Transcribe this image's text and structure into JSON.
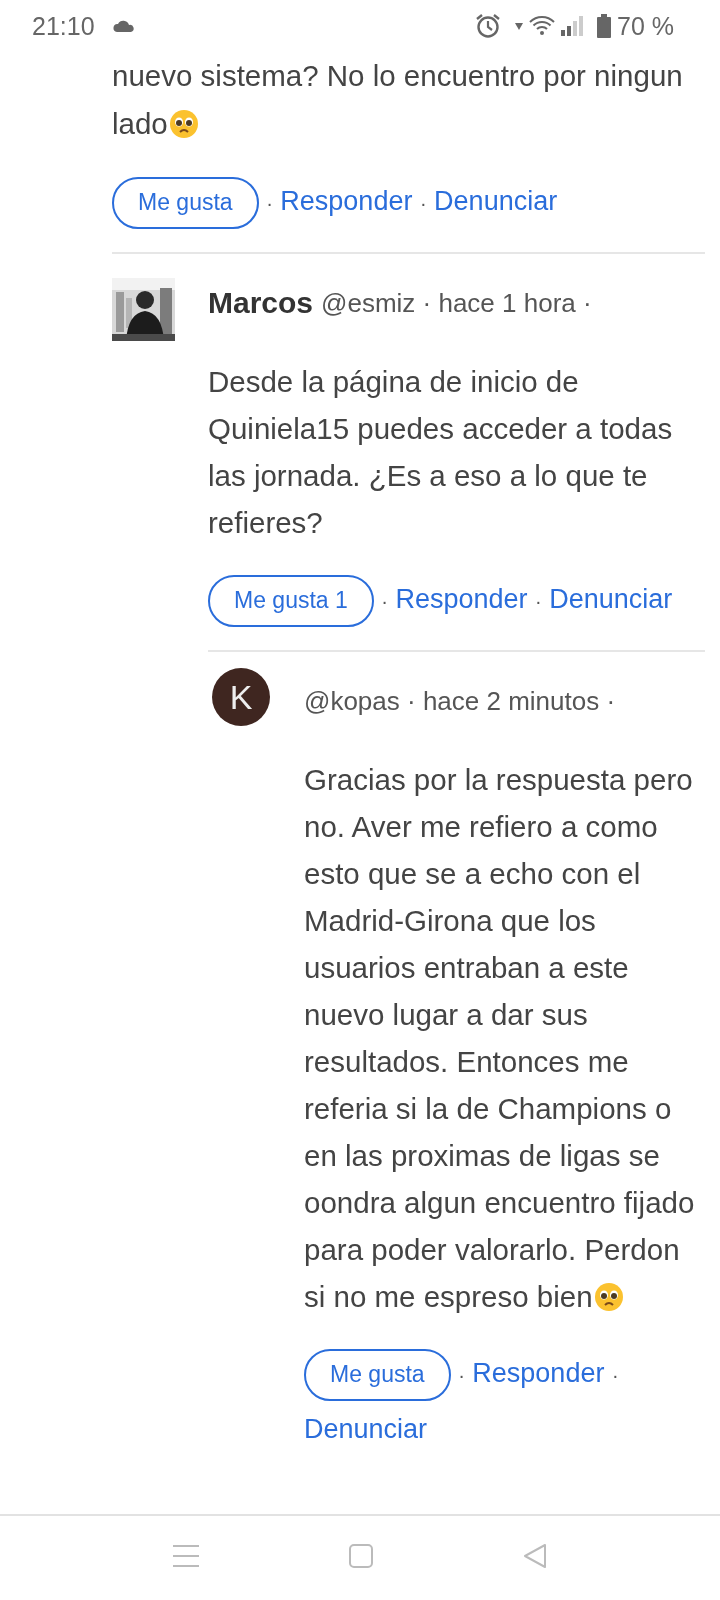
{
  "status_bar": {
    "time": "21:10",
    "battery": "70 %"
  },
  "comments": [
    {
      "body": "nuevo sistema? No lo encuentro por ningun lado",
      "emoji": true,
      "like": "Me gusta",
      "actions": [
        {
          "sep": "·",
          "label": "Responder"
        },
        {
          "sep": "·",
          "label": "Denunciar"
        }
      ],
      "children": [
        {
          "avatar": {
            "kind": "picture"
          },
          "name": "Marcos",
          "meta": "@esmiz · hace 1 hora ·",
          "body": "Desde la página de inicio de Quiniela15 puedes acceder a todas las jornada. ¿Es a eso a lo que te refieres?",
          "emoji": false,
          "like": "Me gusta 1",
          "actions": [
            {
              "sep": "·",
              "label": "Responder"
            },
            {
              "sep": "·",
              "label": "Denunciar"
            }
          ],
          "children": [
            {
              "avatar": {
                "kind": "initial",
                "letter": "K"
              },
              "meta": "@kopas · hace 2 minutos ·",
              "body": "Gracias por la respuesta pero no. Aver me refiero a como esto que se a echo con el Madrid-Girona que los usuarios entraban a este nuevo lugar a dar sus resultados. Entonces me referia si la de Champions o en las proximas de ligas se oondra algun encuentro fijado para poder valorarlo. Perdon si no me espreso bien",
              "emoji": true,
              "like": "Me gusta",
              "actions": [
                {
                  "sep": "·",
                  "label": "Responder"
                },
                {
                  "sep": "·",
                  "label": "Denunciar"
                }
              ]
            }
          ]
        }
      ]
    }
  ]
}
